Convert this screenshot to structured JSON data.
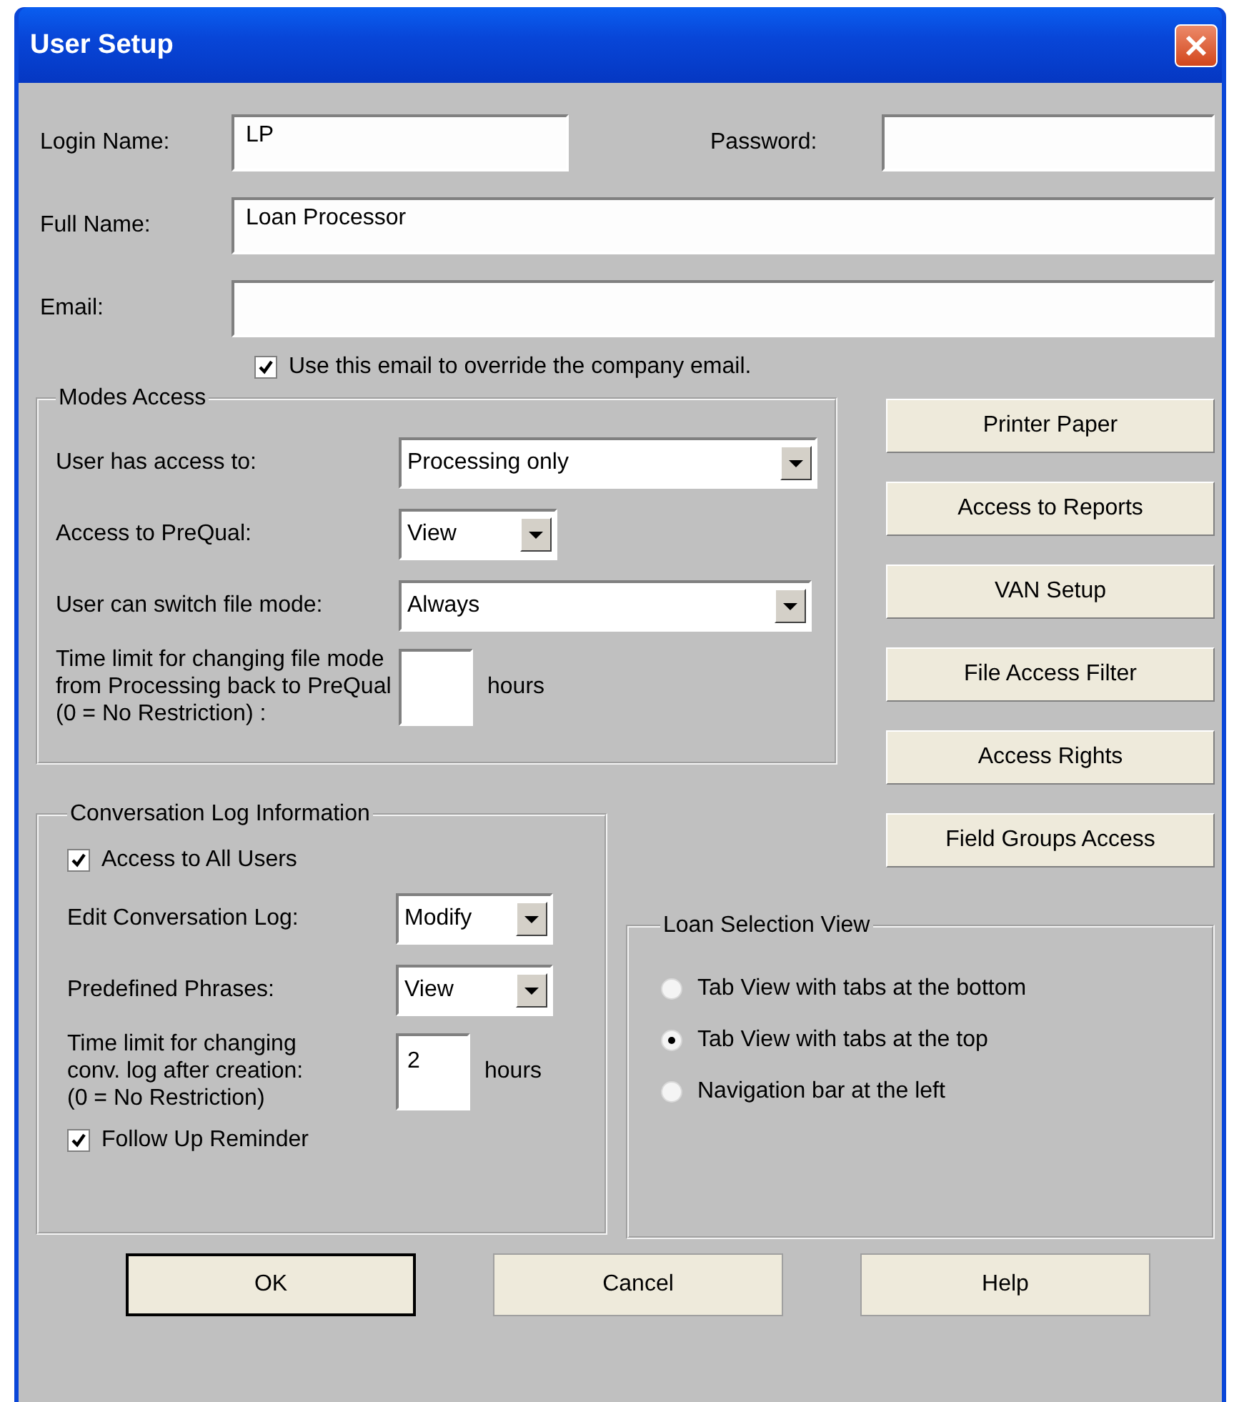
{
  "window": {
    "title": "User Setup"
  },
  "fields": [
    {
      "label": "Login Name:",
      "value": "LP"
    },
    {
      "label": "Password:"
    },
    {
      "label": "Full Name:",
      "value": "Loan Processor"
    },
    {
      "label": "Email:"
    }
  ],
  "email_override": {
    "label": "Use this email to override the company email.",
    "checked": true
  },
  "modes_access": {
    "title": "Modes Access",
    "rows": [
      {
        "kind": "select",
        "label": "User has access to:",
        "value": "Processing only"
      },
      {
        "kind": "select",
        "label": "Access to PreQual:",
        "value": "View"
      },
      {
        "kind": "select",
        "label": "User can switch file mode:",
        "value": "Always"
      },
      {
        "kind": "number",
        "label_lines": [
          "Time limit for changing file mode",
          "from Processing back to PreQual",
          "(0 = No Restriction) :"
        ],
        "unit": "hours"
      }
    ]
  },
  "side_buttons": [
    "Printer Paper",
    "Access to Reports",
    "VAN Setup",
    "File Access Filter",
    "Access Rights",
    "Field Groups Access"
  ],
  "conversation_log": {
    "title": "Conversation Log Information",
    "rows": [
      {
        "kind": "checkbox",
        "label": "Access to All Users",
        "checked": true
      },
      {
        "kind": "select",
        "label": "Edit Conversation Log:",
        "value": "Modify"
      },
      {
        "kind": "select",
        "label": "Predefined Phrases:",
        "value": "View"
      },
      {
        "kind": "number",
        "label_lines": [
          "Time limit for changing",
          "conv. log after creation:",
          "(0 = No Restriction)"
        ],
        "value": "2",
        "unit": "hours"
      },
      {
        "kind": "checkbox",
        "label": "Follow Up Reminder",
        "checked": true
      }
    ]
  },
  "loan_selection_view": {
    "title": "Loan Selection View",
    "options": [
      {
        "label": "Tab View with tabs at the bottom",
        "selected": false
      },
      {
        "label": "Tab View with tabs at the top",
        "selected": true
      },
      {
        "label": "Navigation bar at the left",
        "selected": false
      }
    ]
  },
  "buttons": [
    {
      "label": "OK",
      "default": true
    },
    {
      "label": "Cancel",
      "default": false
    },
    {
      "label": "Help",
      "default": false
    }
  ]
}
